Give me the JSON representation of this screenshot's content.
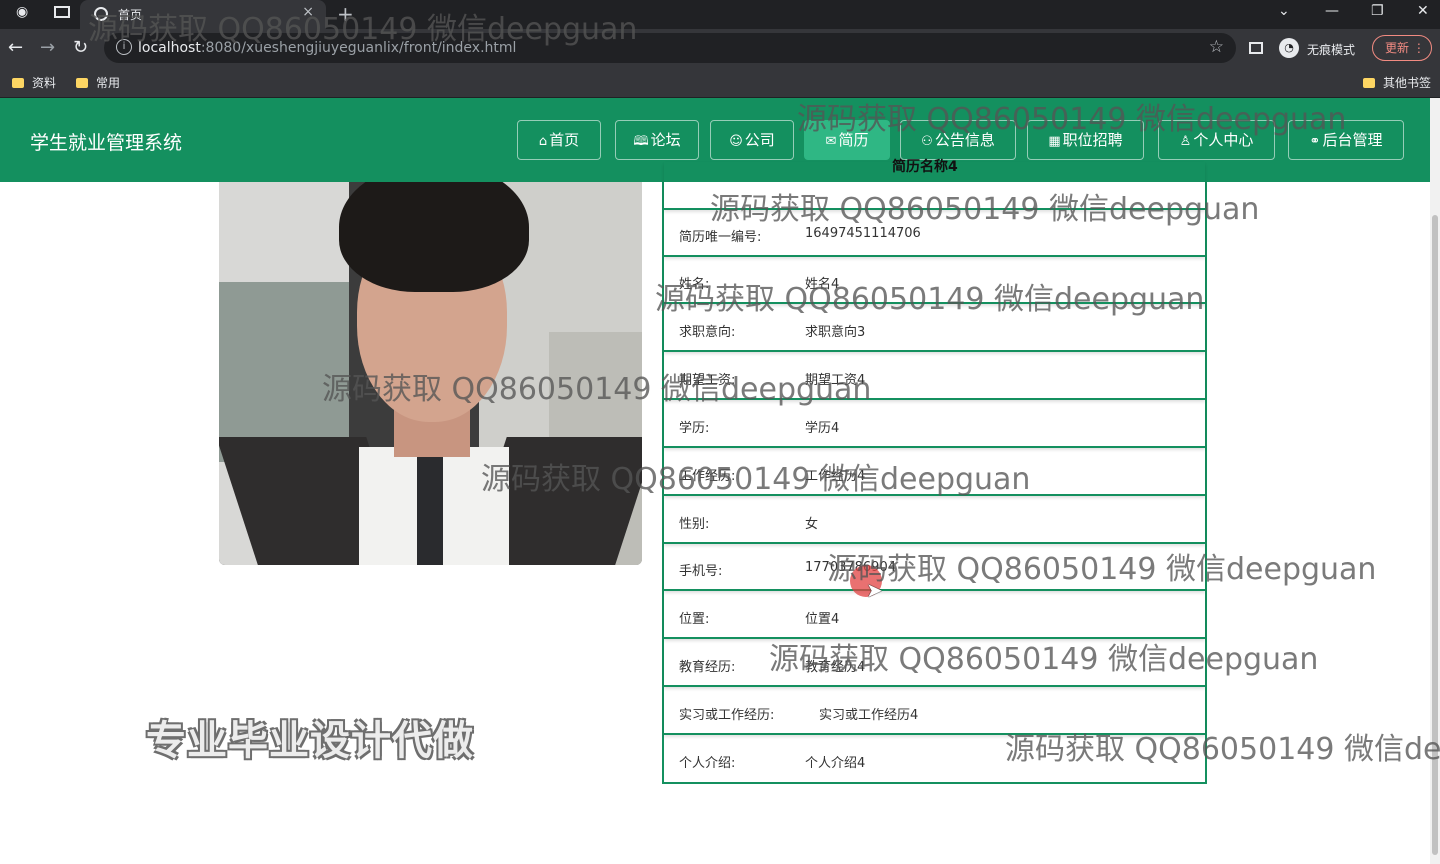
{
  "browser": {
    "tab_title": "首页",
    "tab_close": "×",
    "new_tab": "+",
    "url_host": "localhost",
    "url_rest": ":8080/xueshengjiuyeguanlix/front/index.html",
    "incognito_label": "无痕模式",
    "update_label": "更新",
    "bookmarks": [
      "资料",
      "常用"
    ],
    "other_bookmarks": "其他书签"
  },
  "site": {
    "title": "学生就业管理系统",
    "nav": [
      {
        "icon": "⌂",
        "label": "首页"
      },
      {
        "icon": "🕮",
        "label": "论坛"
      },
      {
        "icon": "☺",
        "label": "公司"
      },
      {
        "icon": "✉",
        "label": "简历"
      },
      {
        "icon": "⚇",
        "label": "公告信息"
      },
      {
        "icon": "▦",
        "label": "职位招聘"
      },
      {
        "icon": "♙",
        "label": "个人中心"
      },
      {
        "icon": "⚭",
        "label": "后台管理"
      }
    ]
  },
  "resume": {
    "title": "简历名称4",
    "rows": [
      {
        "label": "简历唯一编号:",
        "value": "16497451114706"
      },
      {
        "label": "姓名:",
        "value": "姓名4"
      },
      {
        "label": "求职意向:",
        "value": "求职意向3"
      },
      {
        "label": "期望工资:",
        "value": "期望工资4"
      },
      {
        "label": "学历:",
        "value": "学历4"
      },
      {
        "label": "工作经历:",
        "value": "工作经历4"
      },
      {
        "label": "性别:",
        "value": "女"
      },
      {
        "label": "手机号:",
        "value": "17703786904"
      },
      {
        "label": "位置:",
        "value": "位置4"
      },
      {
        "label": "教育经历:",
        "value": "教育经历4"
      },
      {
        "label": "实习或工作经历:",
        "value": "实习或工作经历4"
      },
      {
        "label": "个人介绍:",
        "value": "个人介绍4"
      }
    ]
  },
  "promo_text": "专业毕业设计代做",
  "watermark": "源码获取 QQ86050149 微信deepguan",
  "colors": {
    "header_green": "#14905f",
    "active_nav": "#2fb784"
  }
}
